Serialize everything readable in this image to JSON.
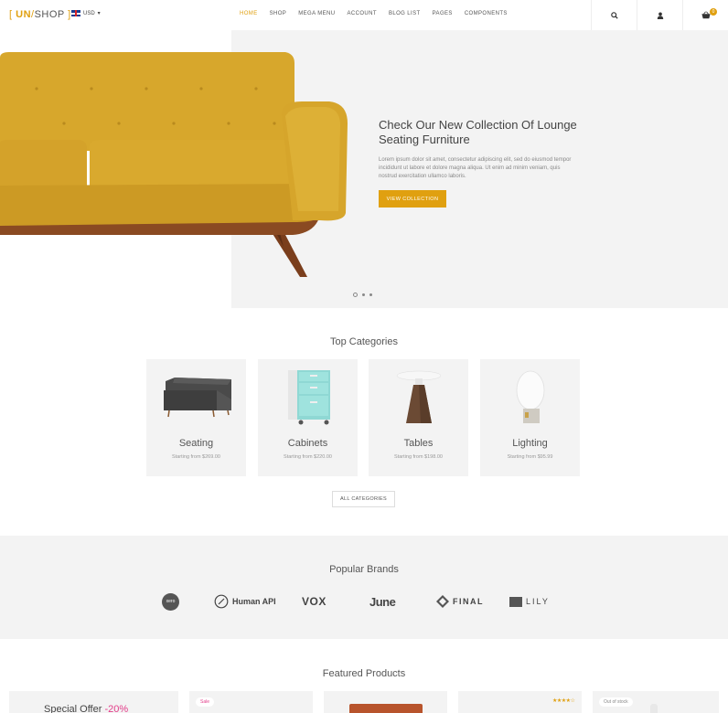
{
  "header": {
    "logo_open": "[",
    "logo_un": "UN",
    "logo_slash": "/",
    "logo_shop": "SHOP",
    "logo_close": "]",
    "currency": "USD",
    "nav": [
      "HOME",
      "SHOP",
      "MEGA MENU",
      "ACCOUNT",
      "BLOG LIST",
      "PAGES",
      "COMPONENTS"
    ],
    "active_nav": "HOME",
    "cart_count": "0",
    "icons": [
      "search-icon",
      "user-icon",
      "basket-icon"
    ]
  },
  "hero": {
    "title": "Check Our New Collection Of Lounge Seating Furniture",
    "text": "Lorem ipsum dolor sit amet, consectetur adipiscing elit, sed do eiusmod tempor incididunt ut labore et dolore magna aliqua. Ut enim ad minim veniam, quis nostrud exercitation ullamco laboris.",
    "button": "VIEW COLLECTION",
    "slides": 3,
    "active_slide": 1
  },
  "categories": {
    "title": "Top Categories",
    "items": [
      {
        "name": "Seating",
        "price": "Starting from $269.00"
      },
      {
        "name": "Cabinets",
        "price": "Starting from $220.00"
      },
      {
        "name": "Tables",
        "price": "Starting from $198.00"
      },
      {
        "name": "Lighting",
        "price": "Starting from $95.99"
      }
    ],
    "all_button": "ALL CATEGORIES"
  },
  "brands": {
    "title": "Popular Brands",
    "items": [
      "xero",
      "Human API",
      "VOX",
      "June",
      "FINAL",
      "LILY"
    ]
  },
  "featured": {
    "title": "Featured Products",
    "offer_text": "Special Offer",
    "offer_pct": "-20%",
    "sale_tag": "Sale",
    "out_of_stock_tag": "Out of stock",
    "rating": "★★★★☆"
  },
  "colors": {
    "accent": "#e0a010",
    "sale": "#e33d8a",
    "panel": "#f3f3f3"
  }
}
